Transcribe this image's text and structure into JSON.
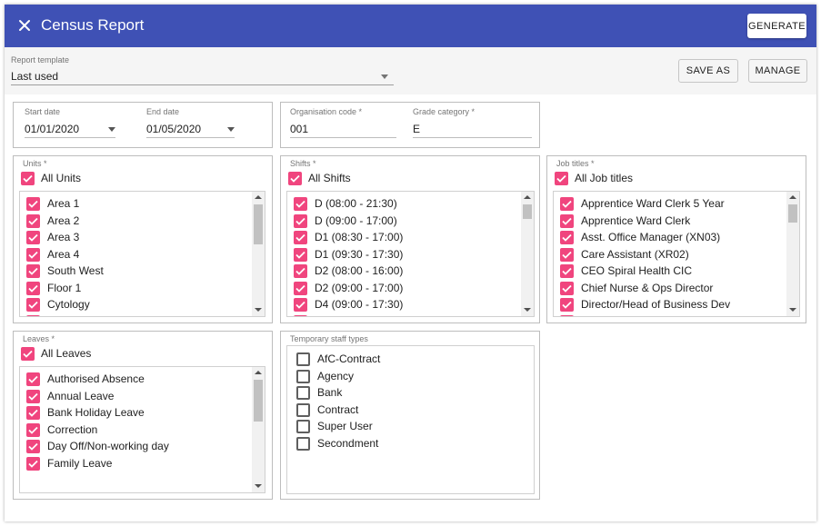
{
  "window": {
    "title": "Census Report",
    "generate_label": "GENERATE"
  },
  "toolbar": {
    "template_label": "Report template",
    "template_value": "Last used",
    "save_as_label": "SAVE AS",
    "manage_label": "MANAGE"
  },
  "dates": {
    "start_label": "Start date",
    "start_value": "01/01/2020",
    "end_label": "End date",
    "end_value": "01/05/2020"
  },
  "org": {
    "org_code_label": "Organisation code *",
    "org_code_value": "001",
    "grade_label": "Grade category *",
    "grade_value": "E"
  },
  "units": {
    "label": "Units *",
    "all_label": "All Units",
    "items": [
      "Area 1",
      "Area 2",
      "Area 3",
      "Area 4",
      "South West",
      "Floor 1",
      "Cytology"
    ]
  },
  "shifts": {
    "label": "Shifts *",
    "all_label": "All Shifts",
    "items": [
      "D (08:00 - 21:30)",
      "D (09:00 - 17:00)",
      "D1 (08:30 - 17:00)",
      "D1 (09:30 - 17:30)",
      "D2 (08:00 - 16:00)",
      "D2 (09:00 - 17:00)",
      "D4 (09:00 - 17:30)"
    ]
  },
  "job_titles": {
    "label": "Job titles *",
    "all_label": "All Job titles",
    "items": [
      "Apprentice Ward Clerk 5 Year",
      "Apprentice Ward Clerk",
      "Asst. Office Manager (XN03)",
      "Care Assistant (XR02)",
      "CEO Spiral Health CIC",
      "Chief Nurse & Ops Director",
      "Director/Head of Business Dev"
    ]
  },
  "leaves": {
    "label": "Leaves *",
    "all_label": "All Leaves",
    "items": [
      "Authorised Absence",
      "Annual Leave",
      "Bank Holiday Leave",
      "Correction",
      "Day Off/Non-working day",
      "Family Leave"
    ]
  },
  "temp_staff": {
    "label": "Temporary staff types",
    "items": [
      "AfC-Contract",
      "Agency",
      "Bank",
      "Contract",
      "Super User",
      "Secondment"
    ]
  },
  "colors": {
    "header": "#3f51b5",
    "checkbox_checked": "#f0457e",
    "toolbar_bg": "#f5f5f5"
  },
  "icons": {
    "close": "close-icon",
    "dropdown": "caret-down-icon",
    "check": "check-icon"
  }
}
